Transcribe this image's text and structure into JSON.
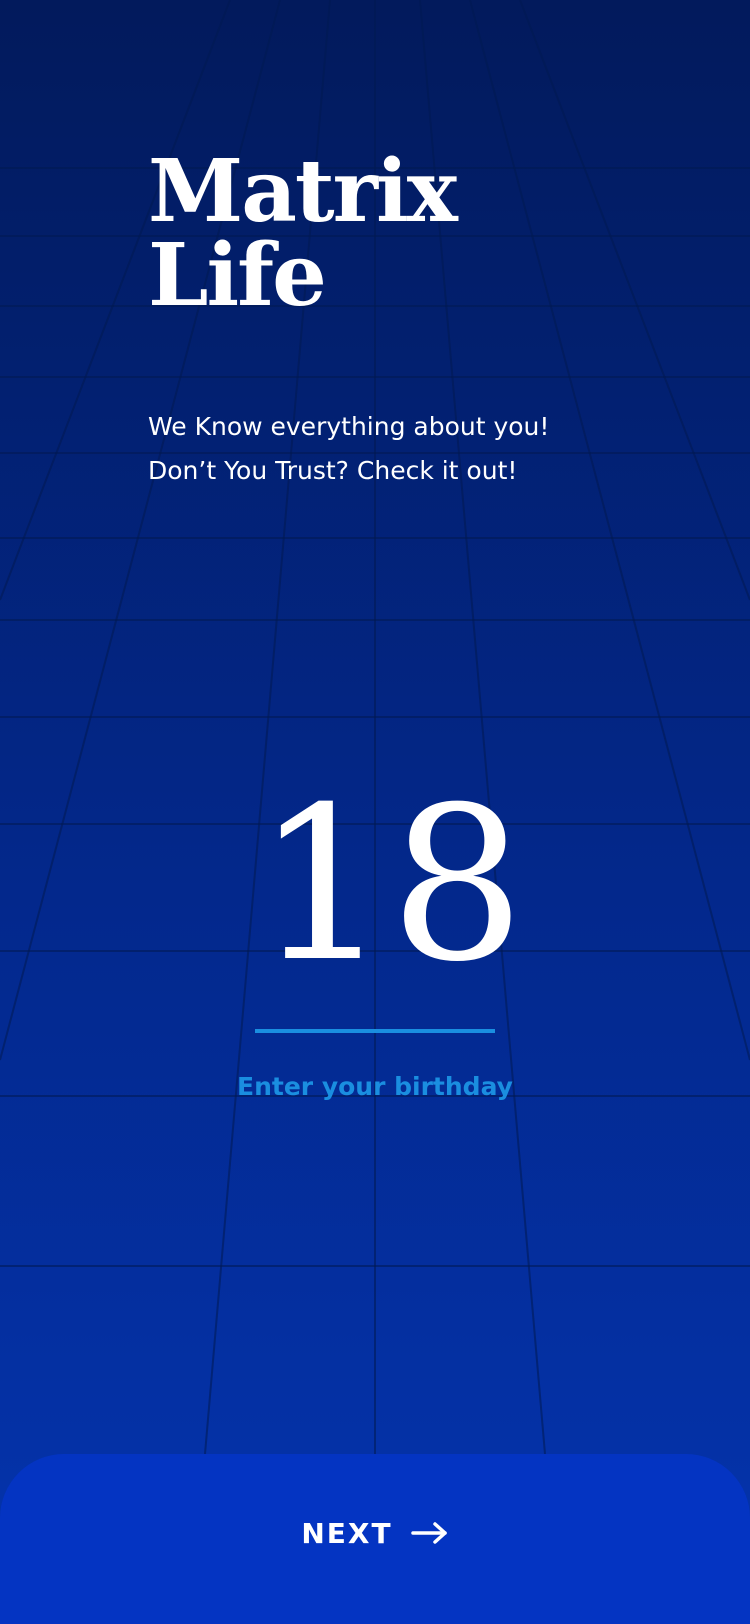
{
  "app": {
    "title_line1": "Matrix",
    "title_line2": "Life"
  },
  "intro": {
    "line1": "We Know everything about you!",
    "line2": "Don’t You Trust? Check it out!"
  },
  "birthday_input": {
    "value": "18",
    "hint": "Enter your birthday"
  },
  "footer": {
    "next_label": "NEXT",
    "next_icon": "arrow-right-icon"
  },
  "colors": {
    "background_top": "#021a5c",
    "background_bottom": "#0434ae",
    "accent": "#1a8ee0",
    "button": "#0434c2",
    "text": "#ffffff"
  }
}
